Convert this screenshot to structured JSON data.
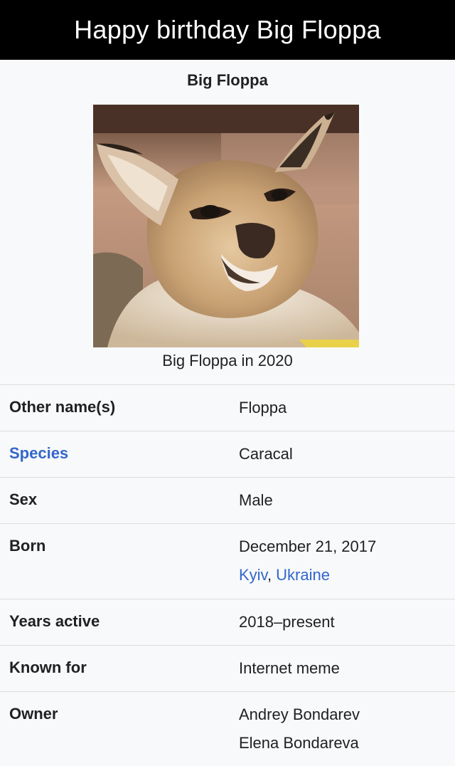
{
  "banner": {
    "text": "Happy birthday Big Floppa"
  },
  "infobox": {
    "title": "Big Floppa",
    "image": {
      "subject": "caracal portrait",
      "icon": "caracal-photo"
    },
    "image_caption": "Big Floppa in 2020",
    "rows": [
      {
        "label": "Other name(s)",
        "values": [
          "Floppa"
        ]
      },
      {
        "label": "Species",
        "values": [
          "Caracal"
        ]
      },
      {
        "label": "Sex",
        "values": [
          "Male"
        ]
      },
      {
        "label": "Born",
        "values": [
          "December 21, 2017"
        ],
        "place": [
          "Kyiv",
          ", ",
          "Ukraine"
        ]
      },
      {
        "label": "Years active",
        "values": [
          "2018–present"
        ]
      },
      {
        "label": "Known for",
        "values": [
          "Internet meme"
        ]
      },
      {
        "label": "Owner",
        "values": [
          "Andrey Bondarev",
          "Elena Bondareva"
        ]
      }
    ]
  },
  "colors": {
    "link": "#3366cc",
    "text": "#202122",
    "background": "#f8f9fa",
    "banner": "#000000"
  }
}
